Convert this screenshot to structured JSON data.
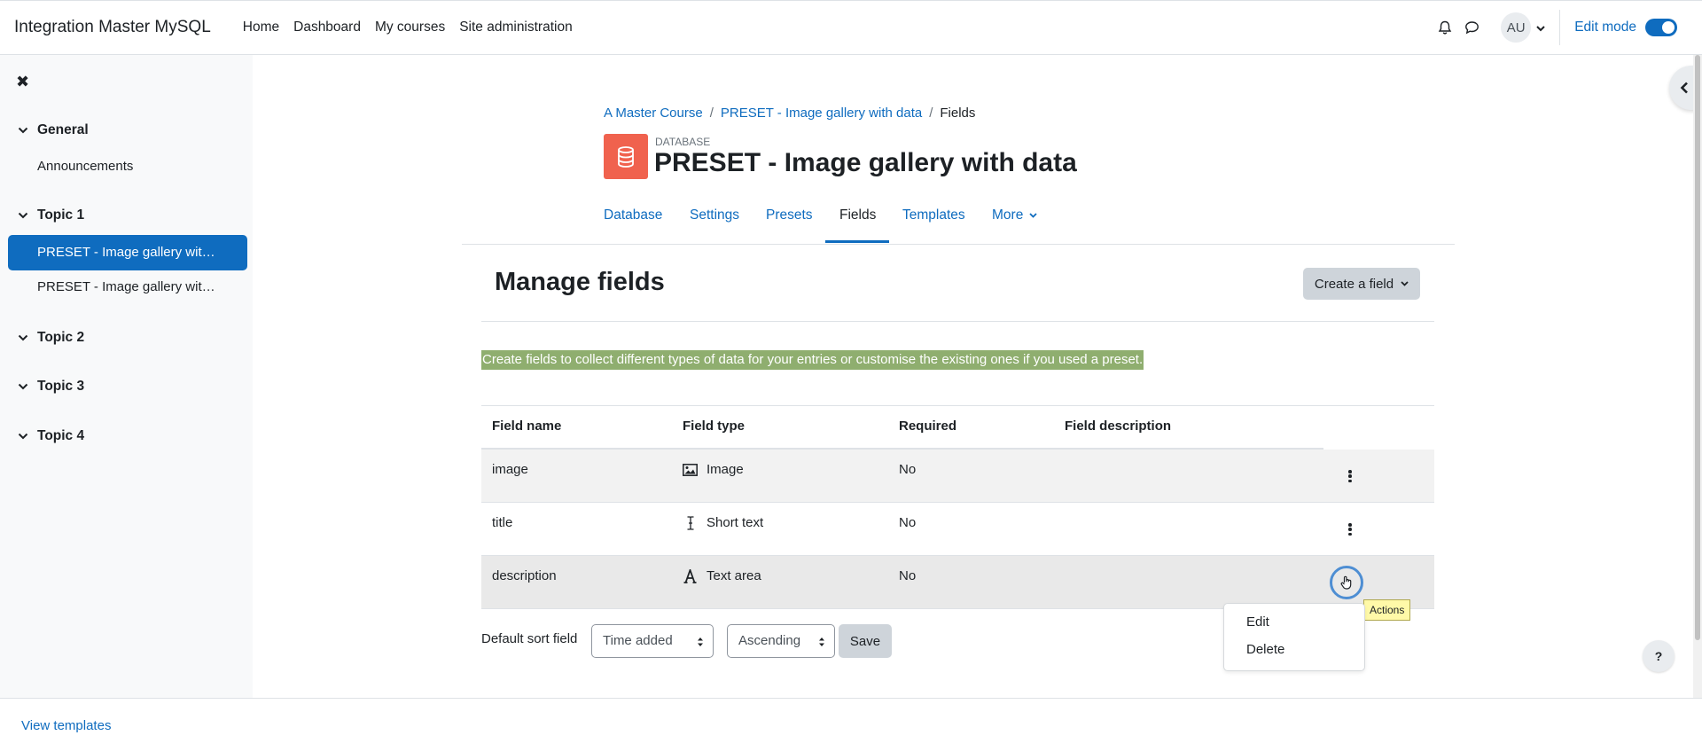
{
  "navbar": {
    "site_name": "Integration Master MySQL",
    "links": [
      "Home",
      "Dashboard",
      "My courses",
      "Site administration"
    ],
    "user_initials": "AU",
    "edit_mode_label": "Edit mode",
    "edit_mode_on": true
  },
  "drawer": {
    "sections": [
      {
        "title": "General",
        "items": [
          "Announcements"
        ]
      },
      {
        "title": "Topic 1",
        "items": [
          "PRESET - Image gallery wit…",
          "PRESET - Image gallery wit…"
        ]
      },
      {
        "title": "Topic 2",
        "items": []
      },
      {
        "title": "Topic 3",
        "items": []
      },
      {
        "title": "Topic 4",
        "items": []
      }
    ]
  },
  "breadcrumb": {
    "course": "A Master Course",
    "activity": "PRESET - Image gallery with data",
    "current": "Fields",
    "separator": "/"
  },
  "header": {
    "pre_title": "DATABASE",
    "title": "PRESET - Image gallery with data"
  },
  "tabs": [
    "Database",
    "Settings",
    "Presets",
    "Fields",
    "Templates",
    "More"
  ],
  "active_tab": "Fields",
  "main": {
    "heading": "Manage fields",
    "create_button": "Create a field",
    "intro": "Create fields to collect different types of data for your entries or customise the existing ones if you used a preset.",
    "table": {
      "headers": [
        "Field name",
        "Field type",
        "Required",
        "Field description"
      ],
      "rows": [
        {
          "name": "image",
          "type": "Image",
          "type_icon": "image-icon",
          "required": "No",
          "description": ""
        },
        {
          "name": "title",
          "type": "Short text",
          "type_icon": "text-cursor-icon",
          "required": "No",
          "description": ""
        },
        {
          "name": "description",
          "type": "Text area",
          "type_icon": "font-icon",
          "required": "No",
          "description": ""
        }
      ]
    },
    "actions_tooltip": "Actions",
    "actions_menu": [
      "Edit",
      "Delete"
    ],
    "sort": {
      "label": "Default sort field",
      "field_value": "Time added",
      "order_value": "Ascending",
      "save_label": "Save"
    }
  },
  "help_label": "?",
  "footer": {
    "link": "View templates"
  },
  "colors": {
    "brand": "#0f6cbf",
    "database_icon": "#f0624e",
    "highlight": "#8fae6f"
  }
}
